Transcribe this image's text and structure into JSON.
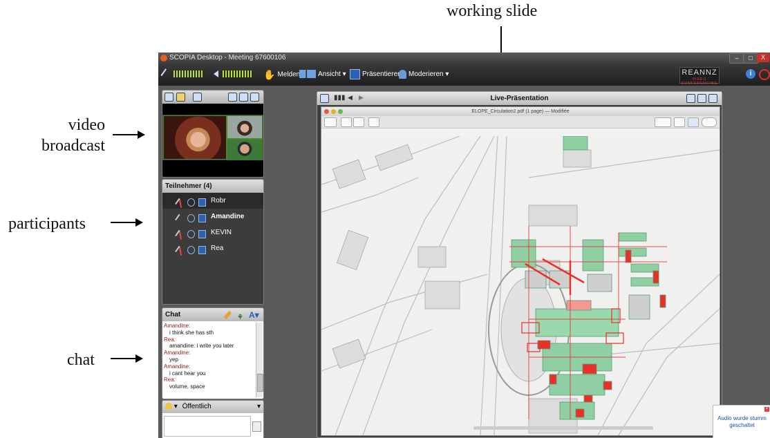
{
  "annotations": {
    "working_slide": "working slide",
    "video_broadcast_l1": "video",
    "video_broadcast_l2": "broadcast",
    "participants": "participants",
    "chat": "chat"
  },
  "window": {
    "title": "SCOPIA Desktop - Meeting 67600106",
    "minimize": "–",
    "maximize": "□",
    "close": "X"
  },
  "toolbar": {
    "raise_hand": "Melden",
    "view": "Ansicht ▾",
    "present": "Präsentieren",
    "moderate": "Moderieren ▾",
    "brand": "REANNZ",
    "brand_sub": "VIDEO CONFERENCING"
  },
  "participants": {
    "header": "Teilnehmer (4)",
    "list": [
      {
        "name": "Robr",
        "bold": false
      },
      {
        "name": "Amandine",
        "bold": true
      },
      {
        "name": "KEVIN",
        "bold": false
      },
      {
        "name": "Rea",
        "bold": false
      }
    ]
  },
  "chat": {
    "header": "Chat",
    "messages": [
      {
        "name": "Amandine:",
        "text": "i think she has sth"
      },
      {
        "name": "Rea:",
        "text": "amandine: i write you later"
      },
      {
        "name": "Amandine:",
        "text": "yep"
      },
      {
        "name": "Amandine:",
        "text": "i cant hear you"
      },
      {
        "name": "Rea:",
        "text": "volume, space"
      }
    ],
    "audience": "Öffentlich"
  },
  "presentation": {
    "title": "Live-Präsentation",
    "doc_title": "ELOPE_Circulation2.pdf (1 page) — Modifiée"
  },
  "notification": {
    "text": "Audio wurde stumm geschaltet"
  },
  "colors": {
    "toolbar_bg": "#1e1e1e",
    "highlight_red": "#e8302a",
    "building_green": "#8fcfa3"
  }
}
